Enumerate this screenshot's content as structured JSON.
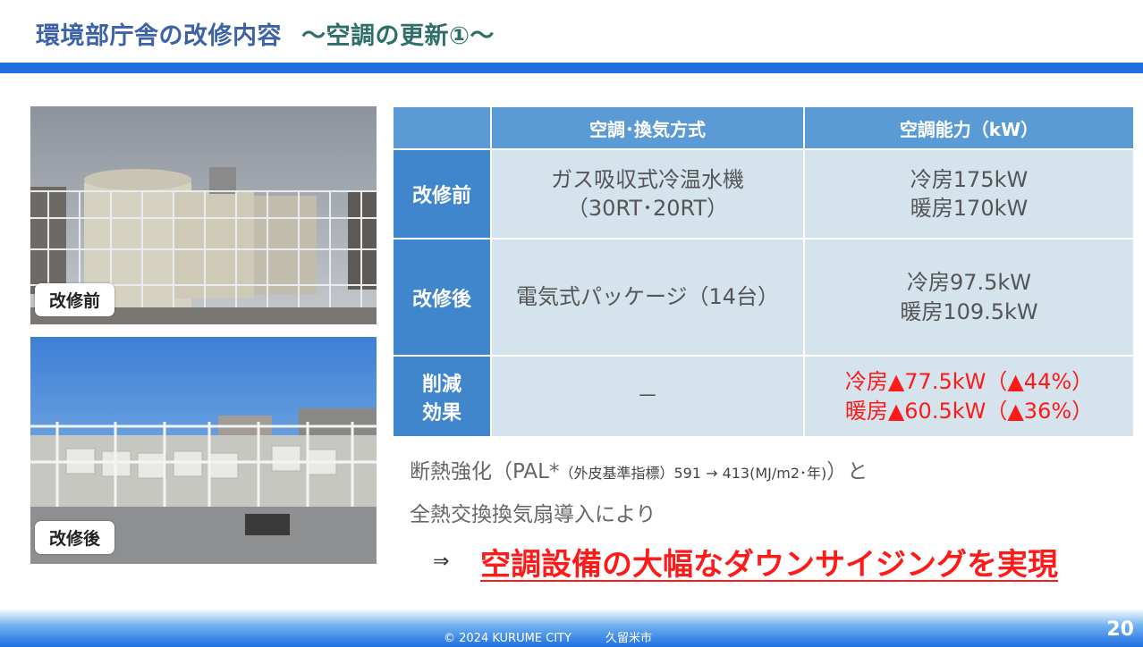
{
  "header": {
    "title": "環境部庁舎の改修内容",
    "subtitle": "～空調の更新①～"
  },
  "photos": {
    "before_label": "改修前",
    "after_label": "改修後"
  },
  "table": {
    "headers": [
      "",
      "空調･換気方式",
      "空調能力（kW）"
    ],
    "rows": [
      {
        "label": "改修前",
        "method": [
          "ガス吸収式冷温水機",
          "（30RT･20RT）"
        ],
        "capacity": [
          "冷房175kW",
          "暖房170kW"
        ]
      },
      {
        "label": "改修後",
        "method": [
          "電気式パッケージ（14台）"
        ],
        "capacity": [
          "冷房97.5kW",
          "暖房109.5kW"
        ]
      },
      {
        "label": [
          "削減",
          "効果"
        ],
        "method": [
          "－"
        ],
        "capacity": [
          "冷房▲77.5kW（▲44%）",
          "暖房▲60.5kW（▲36%）"
        ]
      }
    ]
  },
  "notes": {
    "line1_a": "断熱強化（PAL*",
    "line1_b": "（外皮基準指標）591 → 413(MJ/m2･年)",
    "line1_c": "）と",
    "line2": "全熱交換換気扇導入により",
    "arrow": "⇒",
    "conclusion": "空調設備の大幅なダウンサイジングを実現"
  },
  "footer": {
    "copyright": "© 2024 KURUME CITY",
    "city": "久留米市",
    "page": "20"
  },
  "colors": {
    "accent_blue": "#1f6fe0",
    "title_blue": "#3c63a8",
    "subtitle_teal": "#2f6f6a",
    "highlight_red": "#ff1a1a",
    "table_header": "#5b9bd5",
    "table_cell": "#d5e3ec"
  }
}
